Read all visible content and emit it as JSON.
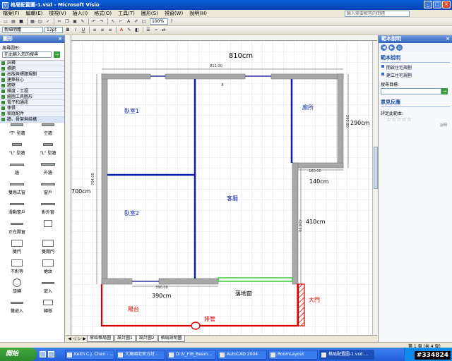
{
  "window": {
    "title": "格局配置圖-1.vsd - Microsoft Visio",
    "controls": [
      "_",
      "□",
      "×"
    ]
  },
  "menu": [
    "檔案(F)",
    "編輯(E)",
    "檢視(V)",
    "插入(I)",
    "格式(O)",
    "工具(T)",
    "圖形(S)",
    "視窗(W)",
    "說明(H)"
  ],
  "help_placeholder": "輸入需要解答的問題",
  "format_toolbar": {
    "font": "新細明體",
    "size": "12pt",
    "zoom": "100%"
  },
  "shapes_panel": {
    "title": "圖形",
    "search_label": "搜尋圖形:",
    "search_placeholder": "在此輸入您的搜尋",
    "stencils": [
      "註釋",
      "標題",
      "出版與標題規劃",
      "建築核心",
      "牆壁",
      "維度 - 工程",
      "繪圖工具圖形",
      "電子和通訊",
      "傢俱",
      "家庭配件",
      "牆、骨架與結構"
    ],
    "shapes": [
      "\"T\" 型牆",
      "空牆",
      "\"L\" 型牆",
      "\"L\" 型牆",
      "牆",
      "外牆",
      "雙懸式窗",
      "窗戶",
      "滑動窗戶",
      "對外窗",
      "正在開窗",
      "",
      "雙門",
      "雙開門",
      "不對等",
      "槍紋",
      "旋轉",
      "嵌入",
      "雙嵌入",
      "轉懸"
    ]
  },
  "plan": {
    "title_dim": "810cm",
    "dim_top_small": "812.00",
    "dim_left": "700cm",
    "dim_left_small": "704.00",
    "dim_right_top": "290cm",
    "dim_right_top_small": "292.00",
    "dim_step": "140cm",
    "dim_step_small": "160.00",
    "dim_right_lower": "410cm",
    "dim_right_lower_small": "424.00",
    "dim_bottom": "390cm",
    "dim_bottom_small": "390.00",
    "dim_mark": "8",
    "rooms": {
      "bedroom1": "臥室1",
      "bedroom2": "臥室2",
      "living": "客廳",
      "toilet": "廁所",
      "balcony": "陽台",
      "french_window": "落地窗",
      "main_door": "大門",
      "drain_pipe": "排管"
    }
  },
  "page_tabs": [
    "原始格局圖",
    "設計圖1",
    "設計圖2",
    "格局說明圖"
  ],
  "task_pane": {
    "title": "範本說明",
    "section_title": "範本說明",
    "links": [
      "開啟住宅規劃",
      "建立住宅規劃"
    ],
    "search_label": "搜尋目標:",
    "feedback_title": "意見反應",
    "rating_label": "評定此範本:",
    "note": "說明"
  },
  "status": {
    "page": "第 1 頁 (共 4 頁)"
  },
  "taskbar": {
    "start": "開始",
    "tasks": [
      "Keith C.J. Chen - ...",
      "大東國宅官方討...",
      "D:\\V_FIB_Beam...",
      "AutoCAD 2004",
      "RoomLayout",
      "格局配置圖-1.vsd ..."
    ],
    "watermark": "#334824"
  }
}
